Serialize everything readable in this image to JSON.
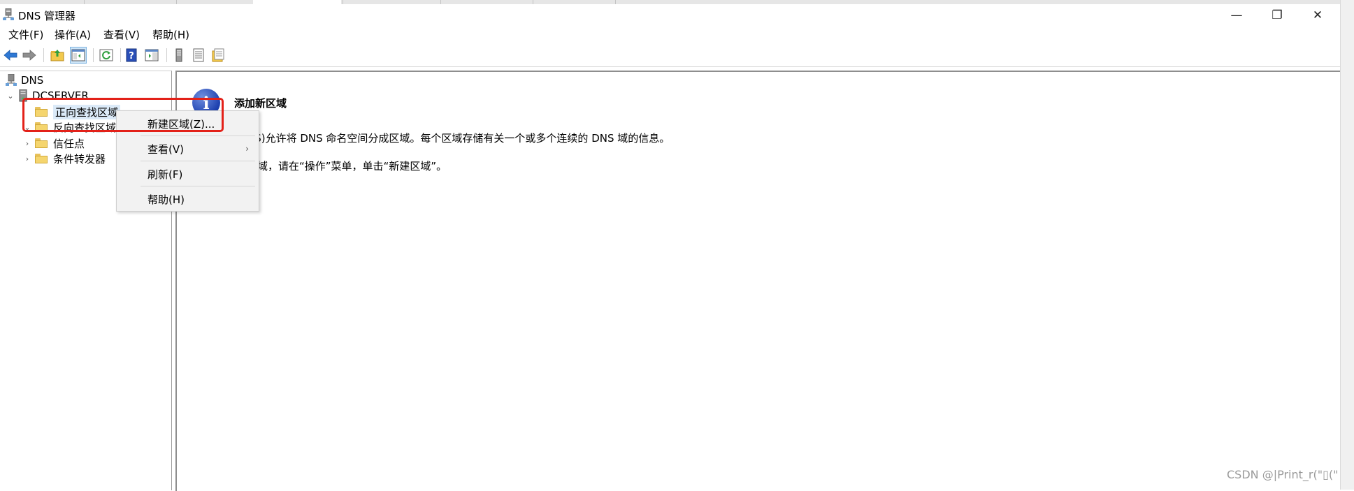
{
  "window": {
    "title": "DNS 管理器",
    "controls": {
      "minimize": "—",
      "restore": "❐",
      "close": "✕"
    }
  },
  "menubar": {
    "items": [
      {
        "label": "文件(F)"
      },
      {
        "label": "操作(A)"
      },
      {
        "label": "查看(V)"
      },
      {
        "label": "帮助(H)"
      }
    ]
  },
  "toolbar": {
    "buttons": [
      "back-arrow-icon",
      "forward-arrow-icon",
      "up-folder-icon",
      "show-hide-console-tree-icon",
      "refresh-icon",
      "help-icon",
      "action-pane-icon",
      "server-icon",
      "list-icon",
      "properties-icon"
    ]
  },
  "tree": {
    "root": {
      "label": "DNS"
    },
    "server": {
      "label": "DCSERVER"
    },
    "items": [
      {
        "label": "正向查找区域",
        "selected": true
      },
      {
        "label": "反向查找区域"
      },
      {
        "label": "信任点"
      },
      {
        "label": "条件转发器"
      }
    ]
  },
  "content": {
    "title": "添加新区域",
    "paragraph1": "NS)允许将 DNS 命名空间分成区域。每个区域存储有关一个或多个连续的 DNS 域的信息。",
    "paragraph2": "区域，请在“操作”菜单，单击“新建区域”。"
  },
  "context_menu": {
    "items": [
      {
        "label": "新建区域(Z)..."
      },
      {
        "label": "查看(V)",
        "submenu_arrow": "›"
      },
      {
        "label": "刷新(F)"
      },
      {
        "label": "帮助(H)"
      }
    ]
  },
  "watermark": "CSDN @|Print_r(\"▯(\"",
  "colors": {
    "highlight": "#e32119",
    "selection": "#dbeaf8",
    "menu_bg": "#f2f2f2"
  }
}
